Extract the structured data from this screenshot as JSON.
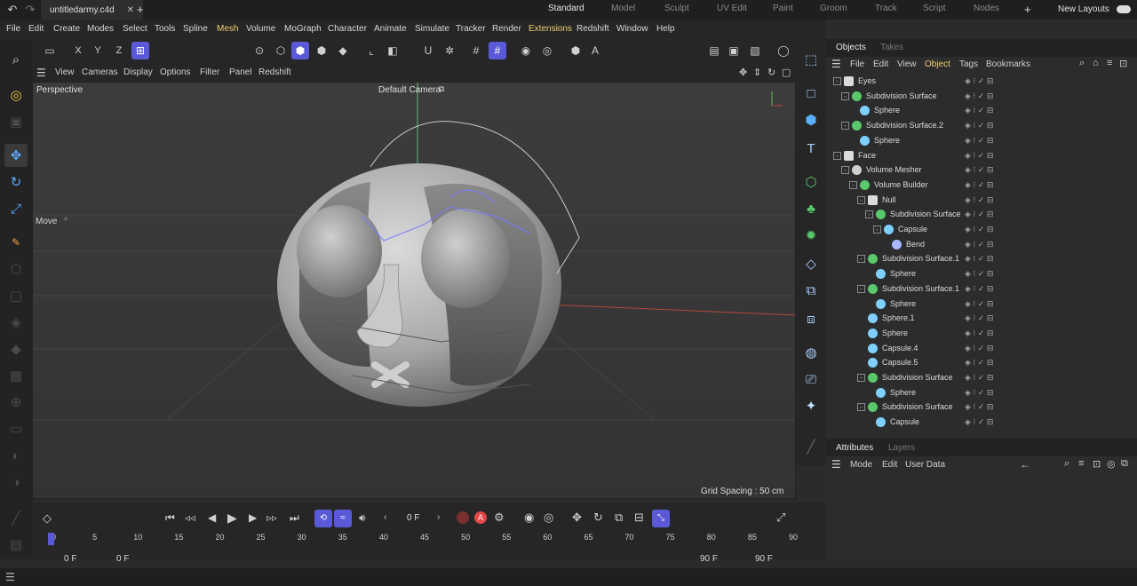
{
  "titlebar": {
    "file_tab": "untitledarmy.c4d",
    "layouts": [
      "Standard",
      "Model",
      "Sculpt",
      "UV Edit",
      "Paint",
      "Groom",
      "Track",
      "Script",
      "Nodes"
    ],
    "new_layouts": "New Layouts"
  },
  "menubar": [
    "File",
    "Edit",
    "Create",
    "Modes",
    "Select",
    "Tools",
    "Spline",
    "Mesh",
    "Volume",
    "MoGraph",
    "Character",
    "Animate",
    "Simulate",
    "Tracker",
    "Render",
    "Extensions",
    "Redshift",
    "Window",
    "Help"
  ],
  "toolbar": {
    "axis_x": "X",
    "axis_y": "Y",
    "axis_z": "Z"
  },
  "viewport_menu": [
    "View",
    "Cameras",
    "Display",
    "Options",
    "Filter",
    "Panel",
    "Redshift"
  ],
  "viewport": {
    "name": "Perspective",
    "camera": "Default Camera",
    "tool_label": "Move",
    "grid_spacing": "Grid Spacing : 50 cm"
  },
  "objects_panel": {
    "tabs": [
      "Objects",
      "Takes"
    ],
    "menu": [
      "File",
      "Edit",
      "View",
      "Object",
      "Tags",
      "Bookmarks"
    ],
    "items": [
      {
        "name": "Eyes",
        "indent": 0,
        "icon": "null-icon",
        "expand": "-"
      },
      {
        "name": "Subdivision Surface",
        "indent": 1,
        "icon": "subdivision-surface-icon",
        "expand": "-"
      },
      {
        "name": "Sphere",
        "indent": 2,
        "icon": "sphere-icon",
        "expand": ""
      },
      {
        "name": "Subdivision Surface.2",
        "indent": 1,
        "icon": "subdivision-surface-icon",
        "expand": "-"
      },
      {
        "name": "Sphere",
        "indent": 2,
        "icon": "sphere-icon",
        "expand": ""
      },
      {
        "name": "Face",
        "indent": 0,
        "icon": "null-icon",
        "expand": "-"
      },
      {
        "name": "Volume Mesher",
        "indent": 1,
        "icon": "volume-mesher-icon",
        "expand": "-"
      },
      {
        "name": "Volume Builder",
        "indent": 2,
        "icon": "volume-builder-icon",
        "expand": "-"
      },
      {
        "name": "Null",
        "indent": 3,
        "icon": "null-icon",
        "expand": "-"
      },
      {
        "name": "Subdivision Surface",
        "indent": 4,
        "icon": "subdivision-surface-icon",
        "expand": "-"
      },
      {
        "name": "Capsule",
        "indent": 5,
        "icon": "capsule-icon",
        "expand": "-"
      },
      {
        "name": "Bend",
        "indent": 6,
        "icon": "bend-deformer-icon",
        "expand": ""
      },
      {
        "name": "Subdivision Surface.1",
        "indent": 3,
        "icon": "subdivision-surface-icon",
        "expand": "-"
      },
      {
        "name": "Sphere",
        "indent": 4,
        "icon": "sphere-icon",
        "expand": ""
      },
      {
        "name": "Subdivision Surface.1",
        "indent": 3,
        "icon": "subdivision-surface-icon",
        "expand": "-"
      },
      {
        "name": "Sphere",
        "indent": 4,
        "icon": "sphere-icon",
        "expand": ""
      },
      {
        "name": "Sphere.1",
        "indent": 3,
        "icon": "sphere-icon",
        "expand": ""
      },
      {
        "name": "Sphere",
        "indent": 3,
        "icon": "sphere-icon",
        "expand": ""
      },
      {
        "name": "Capsule.4",
        "indent": 3,
        "icon": "capsule-icon",
        "expand": ""
      },
      {
        "name": "Capsule.5",
        "indent": 3,
        "icon": "capsule-icon",
        "expand": ""
      },
      {
        "name": "Subdivision Surface",
        "indent": 3,
        "icon": "subdivision-surface-icon",
        "expand": "-"
      },
      {
        "name": "Sphere",
        "indent": 4,
        "icon": "sphere-icon",
        "expand": ""
      },
      {
        "name": "Subdivision Surface",
        "indent": 3,
        "icon": "subdivision-surface-icon",
        "expand": "-"
      },
      {
        "name": "Capsule",
        "indent": 4,
        "icon": "capsule-icon",
        "expand": ""
      }
    ]
  },
  "attributes_panel": {
    "tabs": [
      "Attributes",
      "Layers"
    ],
    "menu": [
      "Mode",
      "Edit",
      "User Data"
    ]
  },
  "timeline": {
    "current_frame": "0 F",
    "ticks": [
      "0",
      "5",
      "10",
      "15",
      "20",
      "25",
      "30",
      "35",
      "40",
      "45",
      "50",
      "55",
      "60",
      "65",
      "70",
      "75",
      "80",
      "85",
      "90"
    ],
    "range_start": "0 F",
    "range_start2": "0 F",
    "range_end": "90 F",
    "range_end2": "90 F"
  },
  "colors": {
    "accent": "#5a5ad8",
    "object_icon": "#7fd0ff",
    "generator_icon": "#59c96b",
    "active_menu": "#f0d070"
  }
}
